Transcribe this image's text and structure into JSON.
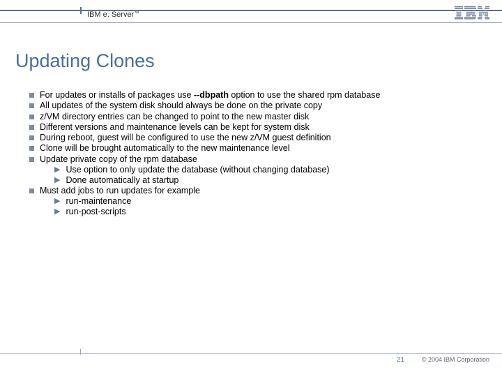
{
  "header": {
    "brand_prefix": "IBM e. ",
    "brand_server": "Server",
    "brand_tm": "™"
  },
  "title": "Updating Clones",
  "bullets": [
    {
      "pre": "For updates or installs of packages use ",
      "bold": "--dbpath",
      "post": " option to use the shared rpm database"
    },
    {
      "text": "All updates of the system disk should always be done on the private copy"
    },
    {
      "text": "z/VM directory entries can be changed to point to the new master disk"
    },
    {
      "text": "Different versions and maintenance levels can be kept for system disk"
    },
    {
      "text": "During reboot, guest will be configured to use the new z/VM guest definition"
    },
    {
      "text": "Clone will be brought automatically to the new maintenance level"
    },
    {
      "text": "Update private copy of the rpm database",
      "subs": [
        "Use option to only update the database (without changing database)",
        "Done automatically at startup"
      ]
    },
    {
      "text": "Must add jobs to run updates for example",
      "subs": [
        "run-maintenance",
        "run-post-scripts"
      ]
    }
  ],
  "footer": {
    "page": "21",
    "copyright": "© 2004 IBM Corporation"
  }
}
